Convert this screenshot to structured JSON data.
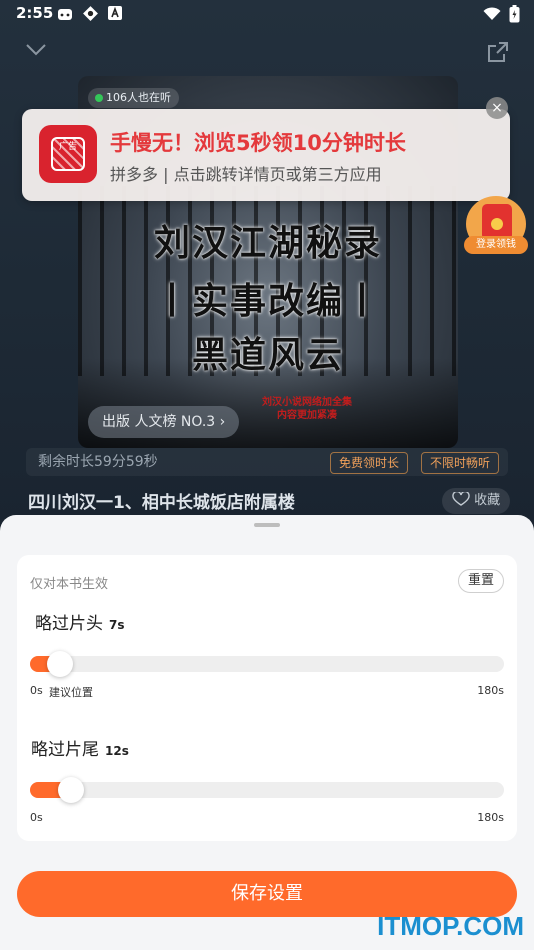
{
  "status_bar": {
    "time": "2:55"
  },
  "player": {
    "listeners": "106人也在听",
    "cover_lines": [
      "刘汉江湖秘录",
      "丨实事改编丨",
      "黑道风云"
    ],
    "cover_small_text": [
      "刘汉小说网络加全集",
      "内容更加紧凑"
    ],
    "rank_label": "出版 人文榜 NO.3 ›",
    "remaining_time": "剩余时长59分59秒",
    "chip_free": "免费领时长",
    "chip_unlimited": "不限时畅听",
    "chapter_title": "四川刘汉一1、相中长城饭店附属楼",
    "favorite_label": "收藏"
  },
  "ad": {
    "tag": "广告",
    "title": "手慢无！浏览5秒领10分钟时长",
    "subtitle": "拼多多 | 点击跳转详情页或第三方应用",
    "close": "×"
  },
  "login_reward": {
    "label": "登录领钱"
  },
  "settings": {
    "scope_label": "仅对本书生效",
    "reset_label": "重置",
    "skip_intro": {
      "title": "略过片头",
      "value": "7s",
      "level": 0.039,
      "min_label": "0s",
      "hint_label": "建议位置",
      "max_label": "180s"
    },
    "skip_outro": {
      "title": "略过片尾",
      "value": "12s",
      "level": 0.067,
      "min_label": "0s",
      "max_label": "180s"
    },
    "save_label": "保存设置"
  },
  "watermark": "ITMOP.COM",
  "colors": {
    "accent": "#ff6a2b",
    "ad_red": "#e4393c",
    "sheet_bg": "#f4f5f7"
  }
}
